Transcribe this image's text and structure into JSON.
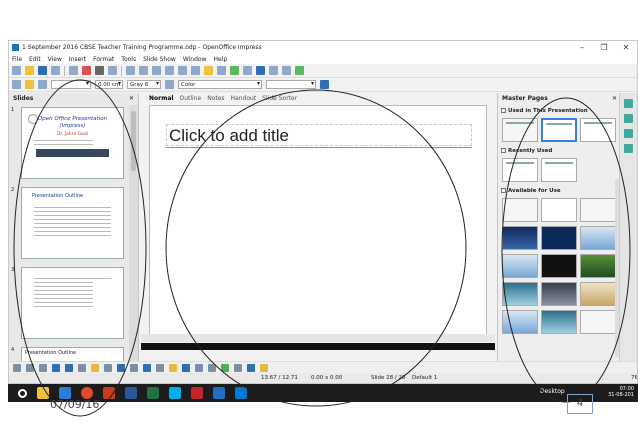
{
  "window": {
    "title": "1 September 2016 CBSE Teacher Training Programme.odp - OpenOffice Impress",
    "controls": {
      "minimize": "–",
      "restore": "❐",
      "close": "✕"
    }
  },
  "menu": [
    "File",
    "Edit",
    "View",
    "Insert",
    "Format",
    "Tools",
    "Slide Show",
    "Window",
    "Help"
  ],
  "formatting": {
    "line_width": "0.00 cm",
    "area_style": "Gray 6",
    "area_fill": "Color"
  },
  "slides_pane": {
    "title": "Slides",
    "close": "✕",
    "thumbs": [
      {
        "num": "1",
        "title": "Open Office Presentation",
        "subtitle": "(Impress)",
        "author": "Dr. Jahra Godi"
      },
      {
        "num": "2",
        "title": "Presentation Outline"
      },
      {
        "num": "3"
      },
      {
        "num": "4",
        "title": "Presentation Outline"
      }
    ]
  },
  "editor": {
    "tabs": [
      "Normal",
      "Outline",
      "Notes",
      "Handout",
      "Slide Sorter"
    ],
    "active_tab": "Normal",
    "title_placeholder": "Click to add title"
  },
  "master_pane": {
    "title": "Master Pages",
    "close": "✕",
    "sections": [
      "Used in This Presentation",
      "Recently Used",
      "Available for Use"
    ]
  },
  "status": {
    "position": "13.67 / 12.71",
    "size": "0.00 x 0.00",
    "slide": "Slide 28 / 28",
    "layout": "Default 1",
    "zoom": "76"
  },
  "taskbar": {
    "desktop_label": "Desktop",
    "time": "07:00",
    "date": "31-08-201"
  },
  "footer": {
    "date": "07/09/16",
    "page": "4"
  }
}
